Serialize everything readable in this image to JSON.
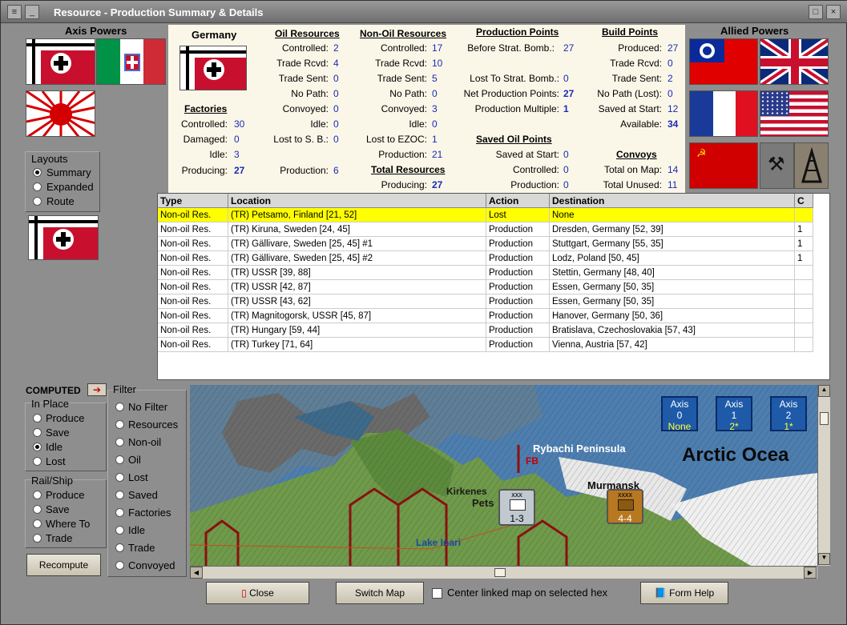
{
  "window": {
    "title": "Resource - Production Summary & Details"
  },
  "axis": {
    "title": "Axis Powers"
  },
  "allied": {
    "title": "Allied Powers"
  },
  "layouts": {
    "title": "Layouts",
    "options": [
      "Summary",
      "Expanded",
      "Route"
    ],
    "selected": "Summary"
  },
  "summary": {
    "country": "Germany",
    "factories": {
      "title": "Factories",
      "rows": [
        {
          "label": "Controlled:",
          "value": "30"
        },
        {
          "label": "Damaged:",
          "value": "0"
        },
        {
          "label": "Idle:",
          "value": "3"
        },
        {
          "label": "Producing:",
          "value": "27"
        }
      ]
    },
    "oil": {
      "title": "Oil Resources",
      "rows": [
        {
          "label": "Controlled:",
          "value": "2"
        },
        {
          "label": "Trade Rcvd:",
          "value": "4"
        },
        {
          "label": "Trade Sent:",
          "value": "0"
        },
        {
          "label": "No Path:",
          "value": "0"
        },
        {
          "label": "Convoyed:",
          "value": "0"
        },
        {
          "label": "Idle:",
          "value": "0"
        },
        {
          "label": "Lost to S. B.:",
          "value": "0"
        },
        {
          "label": "Production:",
          "value": "6"
        }
      ]
    },
    "nonoil": {
      "title": "Non-Oil Resources",
      "rows": [
        {
          "label": "Controlled:",
          "value": "17"
        },
        {
          "label": "Trade Rcvd:",
          "value": "10"
        },
        {
          "label": "Trade Sent:",
          "value": "5"
        },
        {
          "label": "No Path:",
          "value": "0"
        },
        {
          "label": "Convoyed:",
          "value": "3"
        },
        {
          "label": "Idle:",
          "value": "0"
        },
        {
          "label": "Lost to EZOC:",
          "value": "1"
        },
        {
          "label": "Production:",
          "value": "21"
        }
      ]
    },
    "total": {
      "title": "Total Resources",
      "label": "Producing:",
      "value": "27"
    },
    "production_points": {
      "title": "Production Points",
      "rows": [
        {
          "label": "Before Strat. Bomb.:",
          "value": "27"
        },
        {
          "label": "Lost To Strat. Bomb.:",
          "value": "0"
        },
        {
          "label": "Net Production Points:",
          "value": "27"
        },
        {
          "label": "Production Multiple:",
          "value": "1"
        }
      ]
    },
    "saved_oil": {
      "title": "Saved Oil Points",
      "rows": [
        {
          "label": "Saved at Start:",
          "value": "0"
        },
        {
          "label": "Controlled:",
          "value": "0"
        },
        {
          "label": "Production:",
          "value": "0"
        }
      ]
    },
    "build_points": {
      "title": "Build Points",
      "rows": [
        {
          "label": "Produced:",
          "value": "27"
        },
        {
          "label": "Trade Rcvd:",
          "value": "0"
        },
        {
          "label": "Trade Sent:",
          "value": "2"
        },
        {
          "label": "No Path (Lost):",
          "value": "0"
        },
        {
          "label": "Saved at Start:",
          "value": "12"
        },
        {
          "label": "Available:",
          "value": "34"
        }
      ]
    },
    "convoys": {
      "title": "Convoys",
      "rows": [
        {
          "label": "Total on Map:",
          "value": "14"
        },
        {
          "label": "Total Unused:",
          "value": "11"
        }
      ]
    }
  },
  "table": {
    "headers": [
      "Type",
      "Location",
      "Action",
      "Destination",
      "C"
    ],
    "rows": [
      [
        "Non-oil Res.",
        "(TR) Petsamo, Finland [21, 52]",
        "Lost",
        "None",
        ""
      ],
      [
        "Non-oil Res.",
        "(TR) Kiruna, Sweden [24, 45]",
        "Production",
        "Dresden, Germany [52, 39]",
        "1"
      ],
      [
        "Non-oil Res.",
        "(TR) Gällivare, Sweden [25, 45] #1",
        "Production",
        "Stuttgart, Germany [55, 35]",
        "1"
      ],
      [
        "Non-oil Res.",
        "(TR) Gällivare, Sweden [25, 45] #2",
        "Production",
        "Lodz, Poland [50, 45]",
        "1"
      ],
      [
        "Non-oil Res.",
        "(TR) USSR [39, 88]",
        "Production",
        "Stettin, Germany [48, 40]",
        ""
      ],
      [
        "Non-oil Res.",
        "(TR) USSR [42, 87]",
        "Production",
        "Essen, Germany [50, 35]",
        ""
      ],
      [
        "Non-oil Res.",
        "(TR) USSR [43, 62]",
        "Production",
        "Essen, Germany [50, 35]",
        ""
      ],
      [
        "Non-oil Res.",
        "(TR) Magnitogorsk, USSR [45, 87]",
        "Production",
        "Hanover, Germany [50, 36]",
        ""
      ],
      [
        "Non-oil Res.",
        "(TR) Hungary [59, 44]",
        "Production",
        "Bratislava, Czechoslovakia [57, 43]",
        ""
      ],
      [
        "Non-oil Res.",
        "(TR) Turkey [71, 64]",
        "Production",
        "Vienna, Austria [57, 42]",
        ""
      ]
    ]
  },
  "computed": {
    "label": "COMPUTED"
  },
  "in_place": {
    "title": "In Place",
    "options": [
      "Produce",
      "Save",
      "Idle",
      "Lost"
    ],
    "selected": "Idle"
  },
  "rail_ship": {
    "title": "Rail/Ship",
    "options": [
      "Produce",
      "Save",
      "Where To",
      "Trade"
    ]
  },
  "filter": {
    "title": "Filter",
    "options": [
      "No Filter",
      "Resources",
      "Non-oil",
      "Oil",
      "Lost",
      "Saved",
      "Factories",
      "Idle",
      "Trade",
      "Convoyed"
    ]
  },
  "buttons": {
    "recompute": "Recompute",
    "close": "Close",
    "switch_map": "Switch Map",
    "center_linked": "Center linked map on selected hex",
    "form_help": "Form Help"
  },
  "map": {
    "labels": {
      "rybachi": "Rybachi Peninsula",
      "arctic": "Arctic Ocea",
      "kirkenes": "Kirkenes",
      "pets": "Pets",
      "murmansk": "Murmansk",
      "lake_inari": "Lake Inari",
      "fb": "FB"
    },
    "units": [
      {
        "top": "xxx",
        "value": "1-3"
      },
      {
        "top": "xxxx",
        "value": "4-4"
      }
    ],
    "axis_boxes": [
      {
        "label": "Axis",
        "number": "0",
        "sub": "None"
      },
      {
        "label": "Axis",
        "number": "1",
        "sub": "2*"
      },
      {
        "label": "Axis",
        "number": "2",
        "sub": "1*"
      }
    ]
  },
  "colors": {
    "selected_row": "#ffff00",
    "value_blue": "#1a2ab8",
    "panel_bg": "#fbf7e8"
  }
}
